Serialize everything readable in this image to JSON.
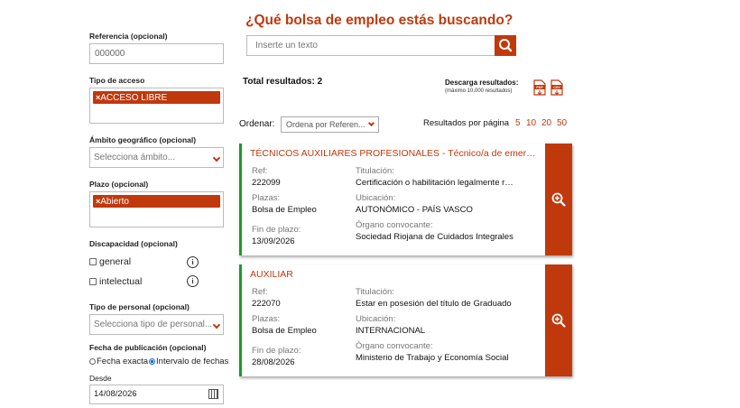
{
  "heading": "¿Qué bolsa de empleo estás buscando?",
  "search": {
    "placeholder": "Inserte un texto"
  },
  "sidebar": {
    "referencia_label": "Referencia (opcional)",
    "referencia_value": "000000",
    "tipo_acceso_label": "Tipo de acceso",
    "tipo_acceso_tags": [
      "ACCESO LIBRE"
    ],
    "ambito_label": "Ámbito geográfico (opcional)",
    "ambito_placeholder": "Selecciona ámbito...",
    "plazo_label": "Plazo (opcional)",
    "plazo_tags": [
      "Abierto"
    ],
    "discapacidad_label": "Discapacidad (opcional)",
    "discapacidad_options": [
      "general",
      "intelectual"
    ],
    "info_glyph": "i",
    "tipo_personal_label": "Tipo de personal (opcional)",
    "tipo_personal_placeholder": "Selecciona tipo de personal...",
    "fecha_label": "Fecha de publicación (opcional)",
    "fecha_options": [
      "Fecha exacta",
      "Intervalo de fechas"
    ],
    "fecha_selected": "Intervalo de fechas",
    "desde_label": "Desde",
    "desde_value": "14/08/2026"
  },
  "results": {
    "total": "Total resultados: 2",
    "download_label": "Descarga resultados:",
    "download_sub": "(máximo 10.000 resultados)",
    "download_formats": [
      "PDF",
      "CSV"
    ],
    "ordenar_label": "Ordenar:",
    "ordenar_value": "Ordena por Referen...",
    "per_page_label": "Resultados por página",
    "per_page_options": [
      "5",
      "10",
      "20",
      "50"
    ]
  },
  "labels": {
    "ref": "Ref:",
    "plazas": "Plazas:",
    "fin": "Fin de plazo:",
    "titulacion": "Titulación:",
    "ubicacion": "Ubicación:",
    "organo": "Órgano convocante:"
  },
  "cards": [
    {
      "title": "TÉCNICOS AUXILIARES PROFESIONALES - Técnico/a de emergencias",
      "ref": "222099",
      "plazas": "Bolsa de Empleo",
      "fin": "13/09/2026",
      "titulacion": "Certificación o habilitación legalmente requerida",
      "ubicacion": "AUTONÓMICO - PAÍS VASCO",
      "organo": "Sociedad Riojana de Cuidados Integrales"
    },
    {
      "title": "AUXILIAR",
      "ref": "222070",
      "plazas": "Bolsa de Empleo",
      "fin": "28/08/2026",
      "titulacion": "Estar en posesión del título de Graduado",
      "ubicacion": "INTERNACIONAL",
      "organo": "Ministerio de Trabajo y Economía Social"
    }
  ],
  "colors": {
    "accent": "#c0390d",
    "card_border": "#1a9a2a",
    "radio_selected": "#1a6ad0"
  }
}
